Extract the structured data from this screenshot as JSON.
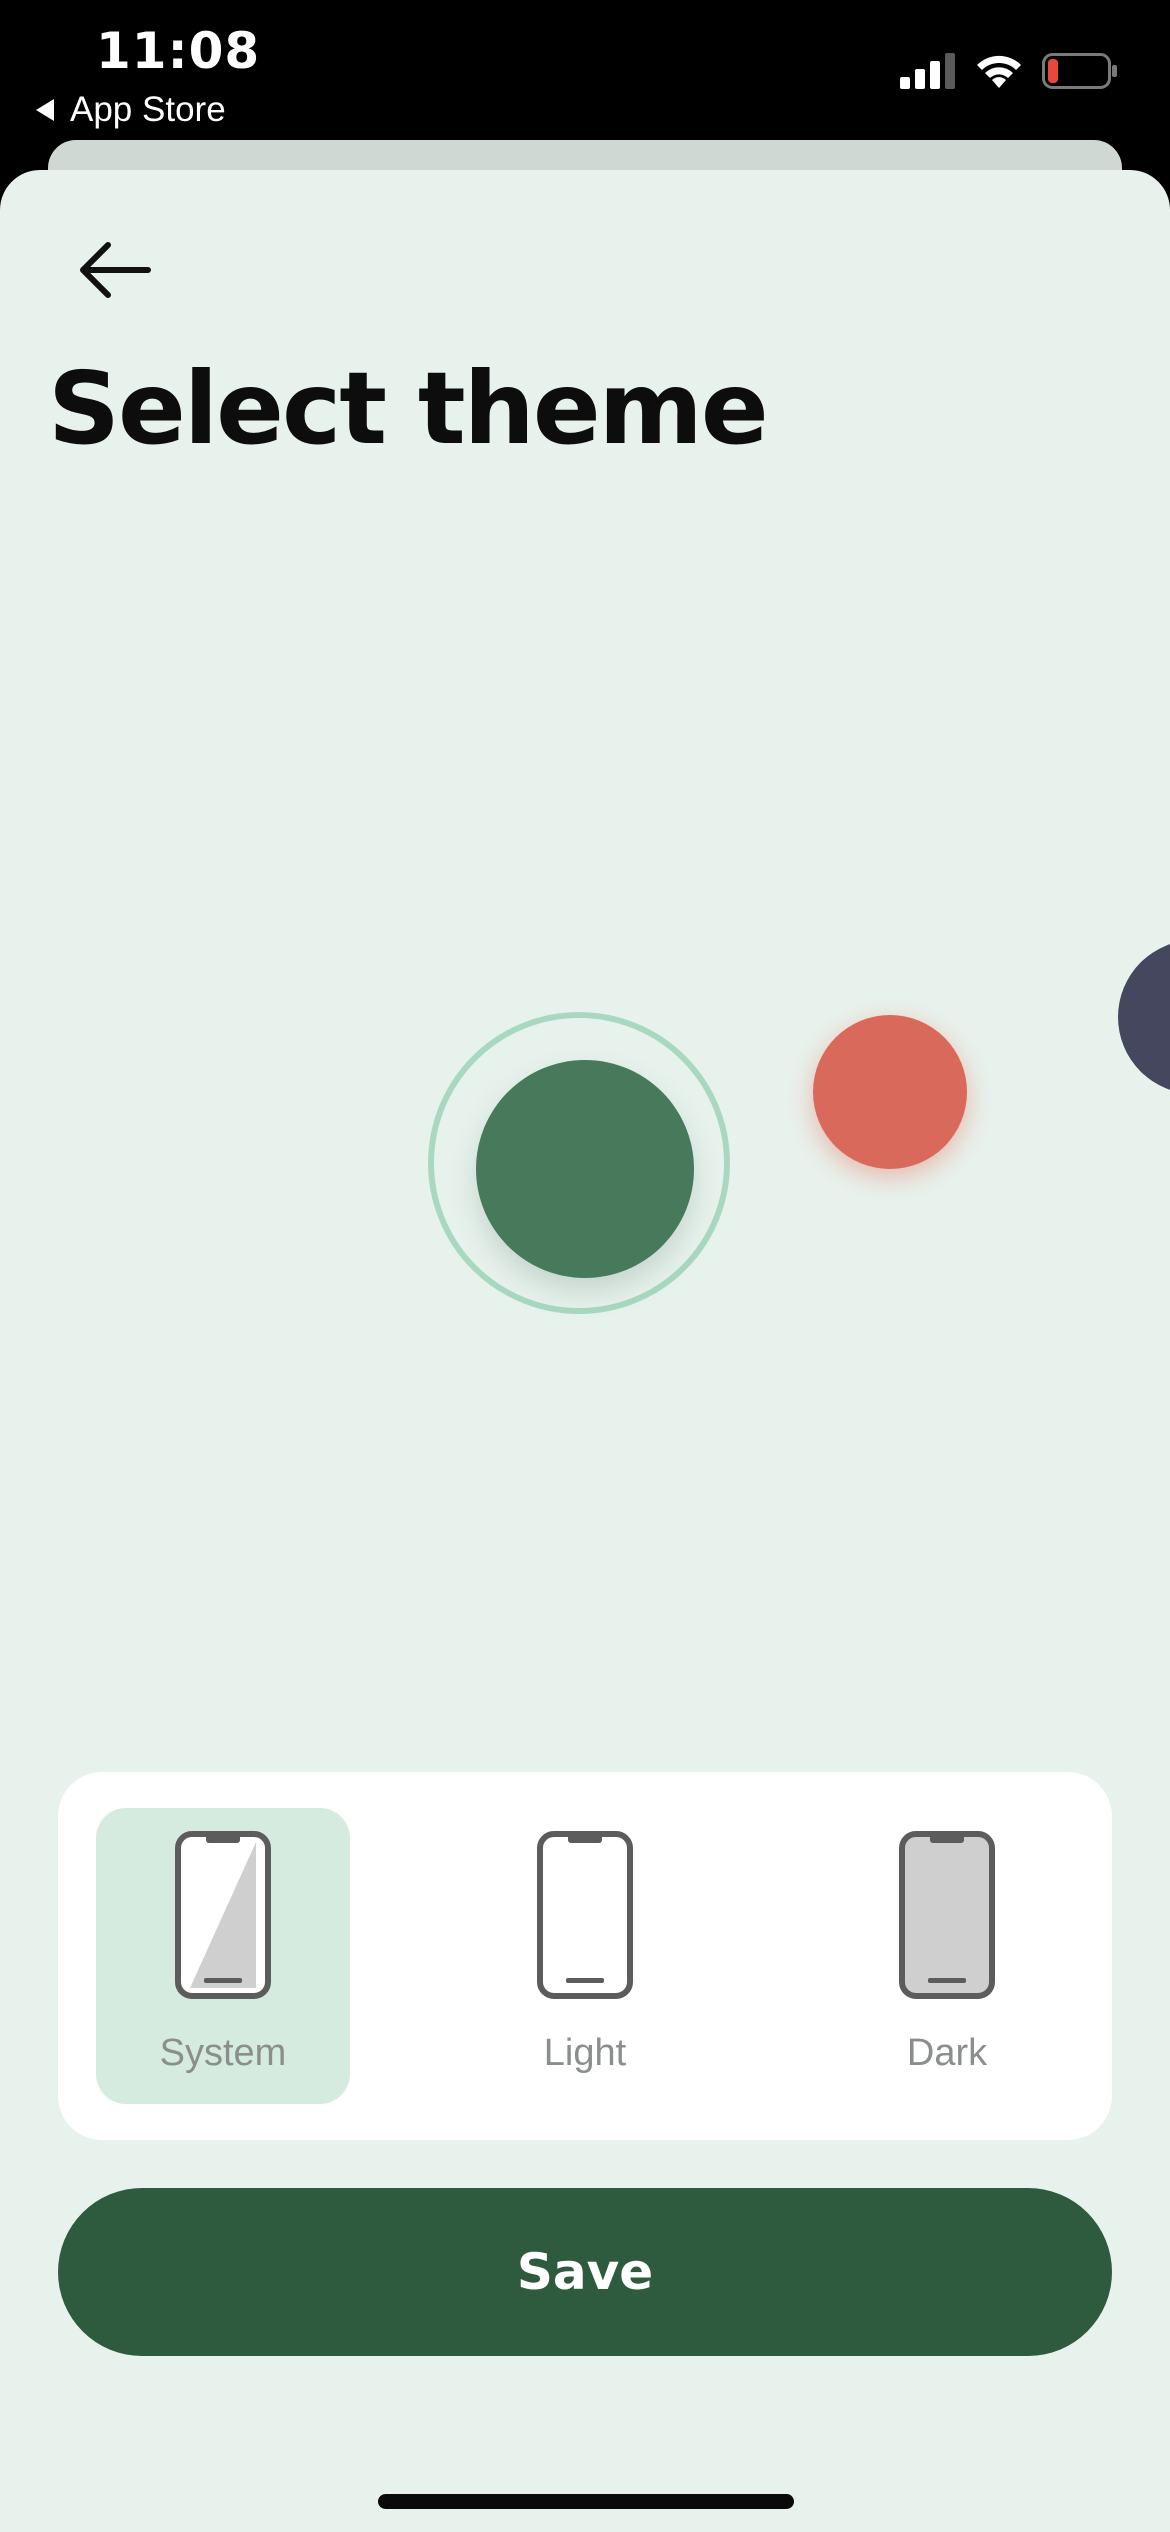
{
  "status_bar": {
    "time": "11:08",
    "back_label": "App Store",
    "battery_color": "#e8473b"
  },
  "header": {
    "back_icon": "arrow-left-icon",
    "title": "Select theme"
  },
  "theme_swatches": [
    {
      "name": "green",
      "color": "#477a5b",
      "selected": true
    },
    {
      "name": "coral",
      "color": "#d9695a",
      "selected": false
    },
    {
      "name": "navy",
      "color": "#45475f",
      "selected": false
    }
  ],
  "appearance_modes": [
    {
      "label": "System",
      "icon": "phone-half-shaded-icon",
      "selected": true
    },
    {
      "label": "Light",
      "icon": "phone-light-icon",
      "selected": false
    },
    {
      "label": "Dark",
      "icon": "phone-dark-icon",
      "selected": false
    }
  ],
  "save_button": {
    "label": "Save",
    "color": "#2e5a3e"
  },
  "colors": {
    "background": "#e8f2ed",
    "selection_ring": "#a8d9c0",
    "selected_mode_bg": "#d5ebe0"
  }
}
